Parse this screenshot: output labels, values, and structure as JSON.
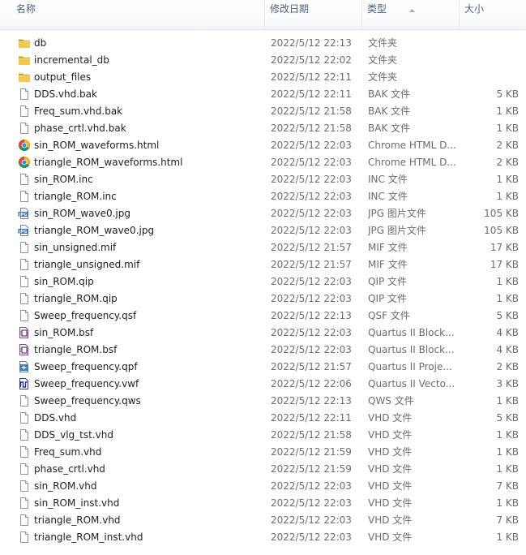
{
  "columns": {
    "name": "名称",
    "date": "修改日期",
    "type": "类型",
    "size": "大小"
  },
  "files": [
    {
      "name": "db",
      "date": "2022/5/12 22:13",
      "type": "文件夹",
      "size": "",
      "icon": "folder-icon"
    },
    {
      "name": "incremental_db",
      "date": "2022/5/12 22:02",
      "type": "文件夹",
      "size": "",
      "icon": "folder-icon"
    },
    {
      "name": "output_files",
      "date": "2022/5/12 22:11",
      "type": "文件夹",
      "size": "",
      "icon": "folder-icon"
    },
    {
      "name": "DDS.vhd.bak",
      "date": "2022/5/12 22:11",
      "type": "BAK 文件",
      "size": "5 KB",
      "icon": "file-icon"
    },
    {
      "name": "Freq_sum.vhd.bak",
      "date": "2022/5/12 21:58",
      "type": "BAK 文件",
      "size": "1 KB",
      "icon": "file-icon"
    },
    {
      "name": "phase_crtl.vhd.bak",
      "date": "2022/5/12 21:58",
      "type": "BAK 文件",
      "size": "1 KB",
      "icon": "file-icon"
    },
    {
      "name": "sin_ROM_waveforms.html",
      "date": "2022/5/12 22:03",
      "type": "Chrome HTML D...",
      "size": "2 KB",
      "icon": "chrome-icon"
    },
    {
      "name": "triangle_ROM_waveforms.html",
      "date": "2022/5/12 22:03",
      "type": "Chrome HTML D...",
      "size": "2 KB",
      "icon": "chrome-icon"
    },
    {
      "name": "sin_ROM.inc",
      "date": "2022/5/12 22:03",
      "type": "INC 文件",
      "size": "1 KB",
      "icon": "file-icon"
    },
    {
      "name": "triangle_ROM.inc",
      "date": "2022/5/12 22:03",
      "type": "INC 文件",
      "size": "1 KB",
      "icon": "file-icon"
    },
    {
      "name": "sin_ROM_wave0.jpg",
      "date": "2022/5/12 22:03",
      "type": "JPG 图片文件",
      "size": "105 KB",
      "icon": "jpg-icon"
    },
    {
      "name": "triangle_ROM_wave0.jpg",
      "date": "2022/5/12 22:03",
      "type": "JPG 图片文件",
      "size": "105 KB",
      "icon": "jpg-icon"
    },
    {
      "name": "sin_unsigned.mif",
      "date": "2022/5/12 21:57",
      "type": "MIF 文件",
      "size": "17 KB",
      "icon": "file-icon"
    },
    {
      "name": "triangle_unsigned.mif",
      "date": "2022/5/12 21:57",
      "type": "MIF 文件",
      "size": "17 KB",
      "icon": "file-icon"
    },
    {
      "name": "sin_ROM.qip",
      "date": "2022/5/12 22:03",
      "type": "QIP 文件",
      "size": "1 KB",
      "icon": "file-icon"
    },
    {
      "name": "triangle_ROM.qip",
      "date": "2022/5/12 22:03",
      "type": "QIP 文件",
      "size": "1 KB",
      "icon": "file-icon"
    },
    {
      "name": "Sweep_frequency.qsf",
      "date": "2022/5/12 22:13",
      "type": "QSF 文件",
      "size": "5 KB",
      "icon": "file-icon"
    },
    {
      "name": "sin_ROM.bsf",
      "date": "2022/5/12 22:03",
      "type": "Quartus II Block...",
      "size": "4 KB",
      "icon": "quartus-block-icon"
    },
    {
      "name": "triangle_ROM.bsf",
      "date": "2022/5/12 22:03",
      "type": "Quartus II Block...",
      "size": "4 KB",
      "icon": "quartus-block-icon"
    },
    {
      "name": "Sweep_frequency.qpf",
      "date": "2022/5/12 21:57",
      "type": "Quartus II Proje...",
      "size": "2 KB",
      "icon": "quartus-project-icon"
    },
    {
      "name": "Sweep_frequency.vwf",
      "date": "2022/5/12 22:06",
      "type": "Quartus II Vecto...",
      "size": "3 KB",
      "icon": "quartus-vector-icon"
    },
    {
      "name": "Sweep_frequency.qws",
      "date": "2022/5/12 22:13",
      "type": "QWS 文件",
      "size": "1 KB",
      "icon": "file-icon"
    },
    {
      "name": "DDS.vhd",
      "date": "2022/5/12 22:11",
      "type": "VHD 文件",
      "size": "5 KB",
      "icon": "file-icon"
    },
    {
      "name": "DDS_vlg_tst.vhd",
      "date": "2022/5/12 21:58",
      "type": "VHD 文件",
      "size": "1 KB",
      "icon": "file-icon"
    },
    {
      "name": "Freq_sum.vhd",
      "date": "2022/5/12 21:59",
      "type": "VHD 文件",
      "size": "1 KB",
      "icon": "file-icon"
    },
    {
      "name": "phase_crtl.vhd",
      "date": "2022/5/12 21:59",
      "type": "VHD 文件",
      "size": "1 KB",
      "icon": "file-icon"
    },
    {
      "name": "sin_ROM.vhd",
      "date": "2022/5/12 22:03",
      "type": "VHD 文件",
      "size": "7 KB",
      "icon": "file-icon"
    },
    {
      "name": "sin_ROM_inst.vhd",
      "date": "2022/5/12 22:03",
      "type": "VHD 文件",
      "size": "1 KB",
      "icon": "file-icon"
    },
    {
      "name": "triangle_ROM.vhd",
      "date": "2022/5/12 22:03",
      "type": "VHD 文件",
      "size": "7 KB",
      "icon": "file-icon"
    },
    {
      "name": "triangle_ROM_inst.vhd",
      "date": "2022/5/12 22:03",
      "type": "VHD 文件",
      "size": "1 KB",
      "icon": "file-icon"
    }
  ],
  "jpg_icon_text": "JPG",
  "colors": {
    "header_text": "#4c607a",
    "name_text": "#1e1e1e",
    "detail_text": "#6d6d6d",
    "folder": "#e8b83c"
  }
}
